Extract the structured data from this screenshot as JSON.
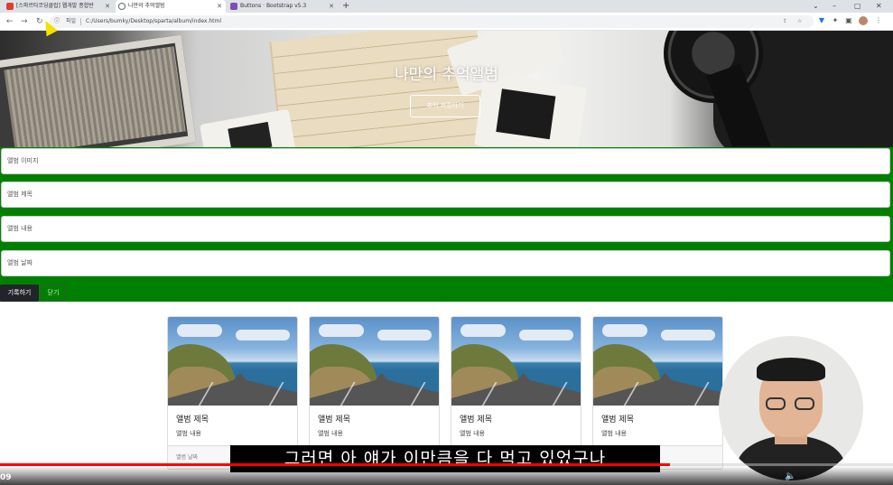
{
  "browser": {
    "tabs": [
      {
        "label": "[스파르타코딩클럽] 웹개발 종합반",
        "favicon_color": "#e03c31"
      },
      {
        "label": "나만의 추억앨범",
        "favicon_color": "#666666"
      },
      {
        "label": "Buttons · Bootstrap v5.3",
        "favicon_color": "#7952b3"
      }
    ],
    "new_tab": "+",
    "omnibox": {
      "scheme_label": "파일",
      "url": "C:/Users/bumky/Desktop/sparta/album/index.html"
    },
    "window_controls": {
      "minimize": "–",
      "maximize": "▢",
      "close": "✕"
    }
  },
  "hero": {
    "title": "나만의 추억앨범",
    "button": "추억 저장하기"
  },
  "form": {
    "fields": [
      {
        "placeholder": "앨범 이미지"
      },
      {
        "placeholder": "앨범 제목"
      },
      {
        "placeholder": "앨범 내용"
      },
      {
        "placeholder": "앨범 날짜"
      }
    ],
    "save_button": "기록하기",
    "close_button": "닫기",
    "background_color": "#008000"
  },
  "cards": [
    {
      "title": "앨범 제목",
      "text": "앨범 내용",
      "date": "앨범 날짜"
    },
    {
      "title": "앨범 제목",
      "text": "앨범 내용",
      "date": ""
    },
    {
      "title": "앨범 제목",
      "text": "앨범 내용",
      "date": ""
    },
    {
      "title": "앨범 제목",
      "text": "앨범 내용",
      "date": ""
    }
  ],
  "video": {
    "subtitle": "그러면 아 얘가 이만큼을 다 먹고 있었구나",
    "timestamp": "09",
    "progress_fraction": 0.75,
    "accent": "#ff0000"
  }
}
